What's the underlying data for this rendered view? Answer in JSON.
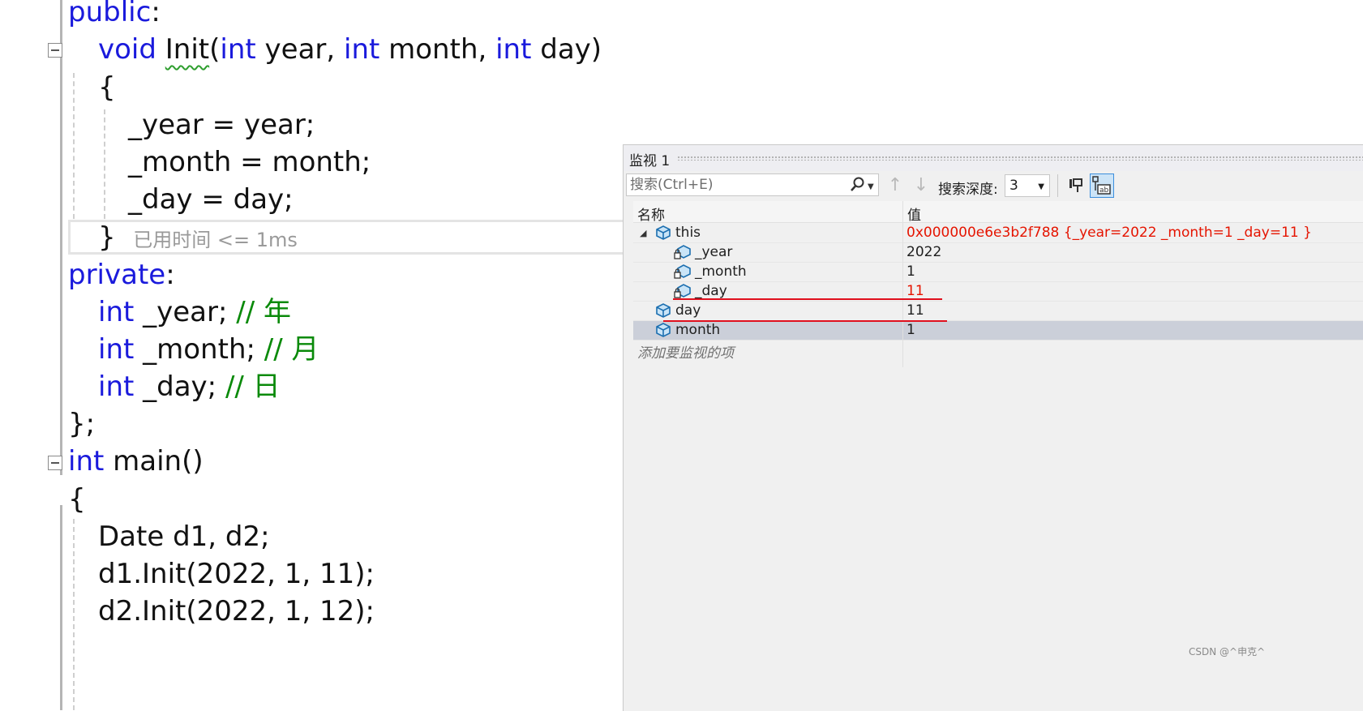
{
  "code": {
    "public_kw": "public",
    "colon": ":",
    "init_void": "void",
    "init_name": "Init",
    "init_open": "(",
    "int_kw": "int",
    "p_year": " year, ",
    "p_month": " month, ",
    "p_day": " day)",
    "brace_open": "{",
    "line_year": "_year = year;",
    "line_month": "_month = month;",
    "line_day": "_day = day;",
    "brace_close": "}",
    "elapsed": "已用时间 <= 1ms",
    "private_kw": "private",
    "m_year": " _year; ",
    "m_month": " _month; ",
    "m_day": " _day; ",
    "c_year": "// 年",
    "c_month": "// 月",
    "c_day": "// 日",
    "class_end": "};",
    "main_rest": " main()",
    "main_open": "{",
    "decl": "Date d1, d2;",
    "call1": "d1.Init(2022, 1, 11);",
    "call2": "d2.Init(2022, 1, 12);"
  },
  "watch": {
    "title": "监视 1",
    "search_placeholder": "搜索(Ctrl+E)",
    "depth_label": "搜索深度:",
    "depth_value": "3",
    "col_name": "名称",
    "col_value": "值",
    "rows": [
      {
        "name": "this",
        "value": "0x000000e6e3b2f788 {_year=2022 _month=1 _day=11 }",
        "changed": true,
        "expanded": true
      },
      {
        "name": "_year",
        "value": "2022",
        "changed": false
      },
      {
        "name": "_month",
        "value": "1",
        "changed": false
      },
      {
        "name": "_day",
        "value": "11",
        "changed": true
      },
      {
        "name": "day",
        "value": "11",
        "changed": false
      },
      {
        "name": "month",
        "value": "1",
        "changed": false,
        "selected": true
      }
    ],
    "add_hint": "添加要监视的项"
  },
  "watermark": "CSDN @^申克^",
  "colors": {
    "keyword": "#1a1adc",
    "comment": "#0a8a0a",
    "changed_value": "#e51400",
    "annotation_red": "#e0101e"
  }
}
